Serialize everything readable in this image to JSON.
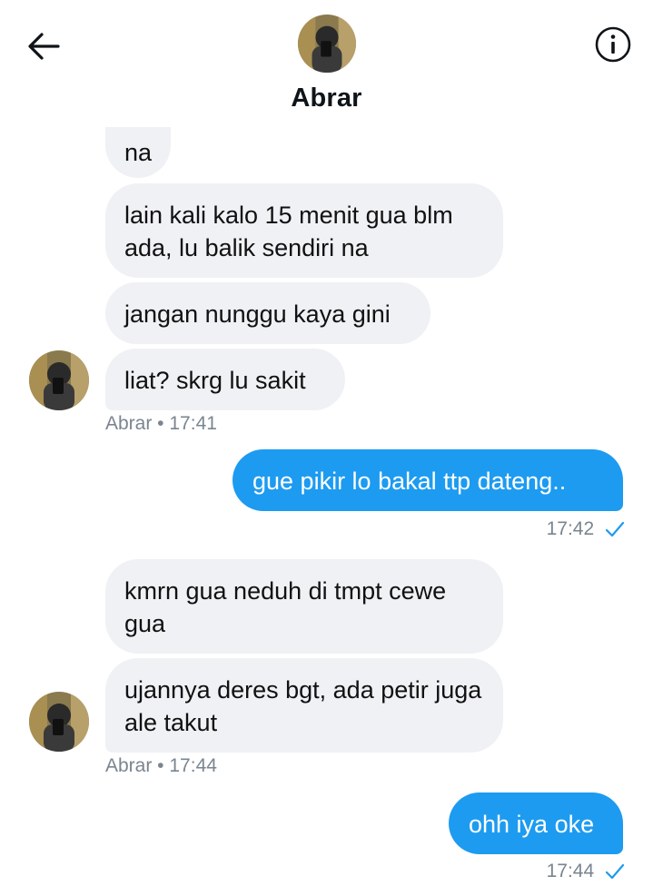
{
  "header": {
    "title": "Abrar",
    "back_icon": "arrow-left-icon",
    "info_icon": "info-icon"
  },
  "messages": [
    {
      "side": "in",
      "text": "na"
    },
    {
      "side": "in",
      "text": "lain kali kalo 15 menit gua blm ada, lu balik sendiri na"
    },
    {
      "side": "in",
      "text": "jangan nunggu kaya gini"
    },
    {
      "side": "in",
      "text": "liat? skrg lu sakit"
    },
    {
      "side": "out",
      "text": "gue pikir lo bakal ttp dateng.."
    },
    {
      "side": "in",
      "text": "kmrn gua neduh di tmpt cewe gua"
    },
    {
      "side": "in",
      "text": "ujannya deres bgt, ada petir juga ale takut"
    },
    {
      "side": "out",
      "text": "ohh iya oke"
    }
  ],
  "meta": {
    "group1": "Abrar • 17:41",
    "out1_time": "17:42",
    "group2": "Abrar • 17:44",
    "out2_time": "17:44"
  },
  "colors": {
    "accent": "#1d9bf0",
    "incoming_bubble": "#eff1f4",
    "meta_text": "#7a8590"
  }
}
